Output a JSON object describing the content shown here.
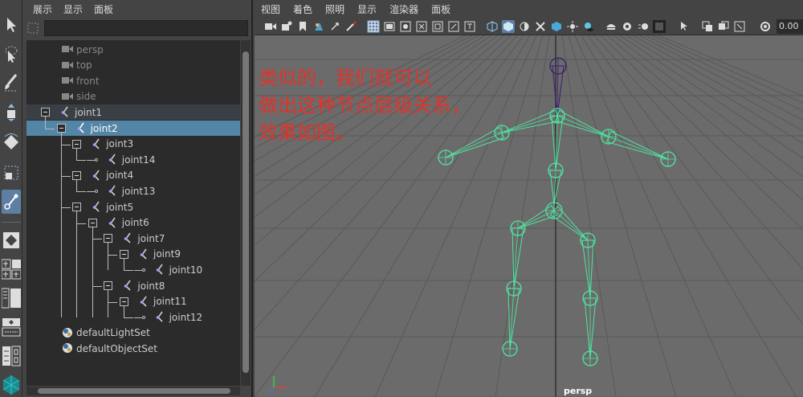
{
  "outliner": {
    "menu": [
      "展示",
      "显示",
      "面板"
    ],
    "search": {
      "value": "",
      "placeholder": ""
    },
    "items": [
      {
        "label": "persp",
        "type": "camera",
        "state": "dim"
      },
      {
        "label": "top",
        "type": "camera",
        "state": "dim"
      },
      {
        "label": "front",
        "type": "camera",
        "state": "dim"
      },
      {
        "label": "side",
        "type": "camera",
        "state": "dim"
      },
      {
        "label": "joint1",
        "type": "joint",
        "state": "highlight"
      },
      {
        "label": "joint2",
        "type": "joint",
        "state": "selected"
      },
      {
        "label": "joint3",
        "type": "joint",
        "state": "normal"
      },
      {
        "label": "joint14",
        "type": "joint",
        "state": "normal"
      },
      {
        "label": "joint4",
        "type": "joint",
        "state": "normal"
      },
      {
        "label": "joint13",
        "type": "joint",
        "state": "normal"
      },
      {
        "label": "joint5",
        "type": "joint",
        "state": "normal"
      },
      {
        "label": "joint6",
        "type": "joint",
        "state": "normal"
      },
      {
        "label": "joint7",
        "type": "joint",
        "state": "normal"
      },
      {
        "label": "joint9",
        "type": "joint",
        "state": "normal"
      },
      {
        "label": "joint10",
        "type": "joint",
        "state": "normal"
      },
      {
        "label": "joint8",
        "type": "joint",
        "state": "normal"
      },
      {
        "label": "joint11",
        "type": "joint",
        "state": "normal"
      },
      {
        "label": "joint12",
        "type": "joint",
        "state": "normal"
      },
      {
        "label": "defaultLightSet",
        "type": "set",
        "state": "normal"
      },
      {
        "label": "defaultObjectSet",
        "type": "set",
        "state": "normal"
      }
    ]
  },
  "viewport": {
    "menu": [
      "视图",
      "着色",
      "照明",
      "显示",
      "渲染器",
      "面板"
    ],
    "field_value": "0.00",
    "annotation": [
      "类似的，我们就可以",
      "做出这种节点层级关系，",
      "效果如图。"
    ],
    "camera_label": "persp"
  },
  "colors": {
    "selection": "#5285a6",
    "joint": "#4fe3a0",
    "selected_joint": "#3a1c6e",
    "annotation": "#e0332b"
  },
  "tools": [
    "select-tool-icon",
    "lasso-tool-icon",
    "paint-tool-icon",
    "move-tool-icon",
    "rotate-tool-icon",
    "scale-tool-icon",
    "joint-tool-icon",
    "layout-single-icon",
    "layout-quad-icon",
    "layout-side-icon",
    "layout-strip-icon",
    "layout-panel-icon",
    "layout-outliner-icon"
  ]
}
